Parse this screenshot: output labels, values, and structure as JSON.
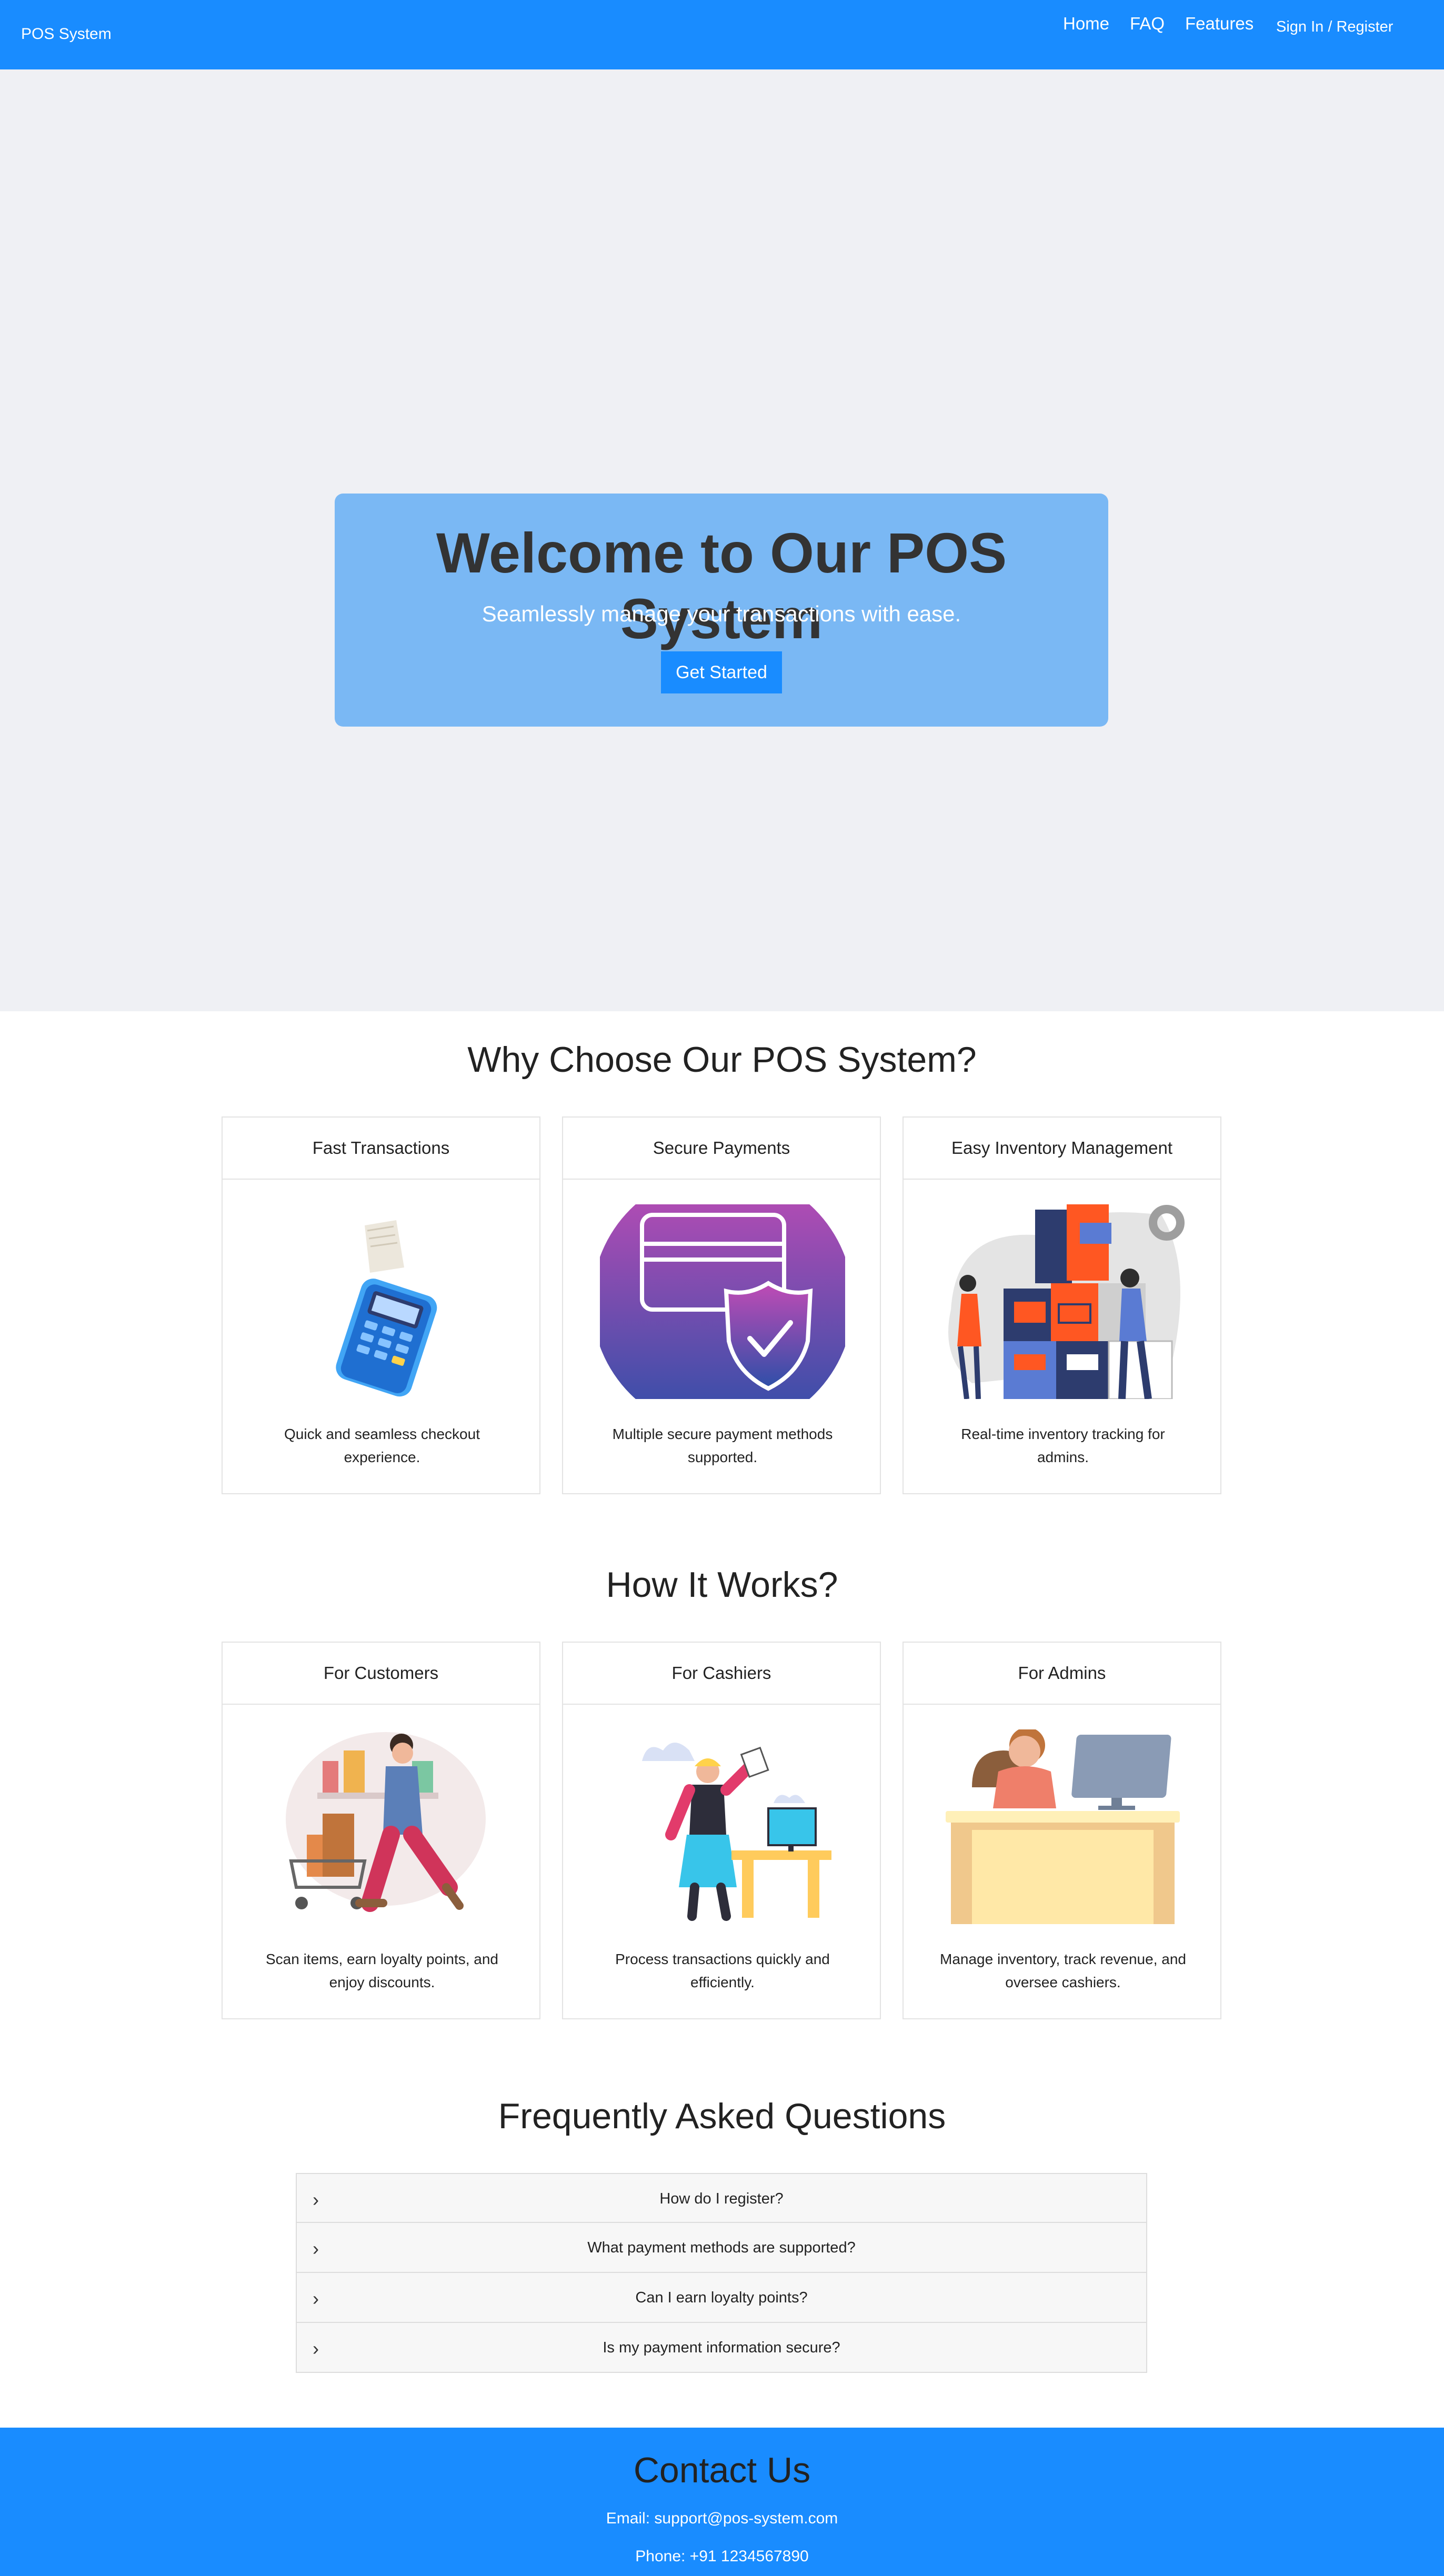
{
  "navbar": {
    "brand": "POS System",
    "links": [
      "Home",
      "FAQ",
      "Features"
    ],
    "signin_label": "Sign In / Register"
  },
  "hero": {
    "title": "Welcome to Our POS System",
    "subtitle": "Seamlessly manage your transactions with ease.",
    "cta_label": "Get Started"
  },
  "why": {
    "title": "Why Choose Our POS System?",
    "cards": [
      {
        "title": "Fast Transactions",
        "text": "Quick and seamless checkout experience.",
        "icon": "card-payment-terminal-icon"
      },
      {
        "title": "Secure Payments",
        "text": "Multiple secure payment methods supported.",
        "icon": "credit-card-shield-icon"
      },
      {
        "title": "Easy Inventory Management",
        "text": "Real-time inventory tracking for admins.",
        "icon": "inventory-boxes-icon"
      }
    ]
  },
  "how": {
    "title": "How It Works?",
    "cards": [
      {
        "title": "For Customers",
        "text": "Scan items, earn loyalty points, and enjoy discounts.",
        "icon": "shopper-cart-icon"
      },
      {
        "title": "For Cashiers",
        "text": "Process transactions quickly and efficiently.",
        "icon": "cashier-counter-icon"
      },
      {
        "title": "For Admins",
        "text": "Manage inventory, track revenue, and oversee cashiers.",
        "icon": "admin-desk-icon"
      }
    ]
  },
  "faq": {
    "title": "Frequently Asked Questions",
    "items": [
      "How do I register?",
      "What payment methods are supported?",
      "Can I earn loyalty points?",
      "Is my payment information secure?"
    ]
  },
  "contact": {
    "title": "Contact Us",
    "email": "Email: support@pos-system.com",
    "phone": "Phone: +91 1234567890"
  },
  "colors": {
    "primary": "#198cff",
    "hero_bg": "#eff0f4",
    "hero_box": "#7ab8f4"
  }
}
